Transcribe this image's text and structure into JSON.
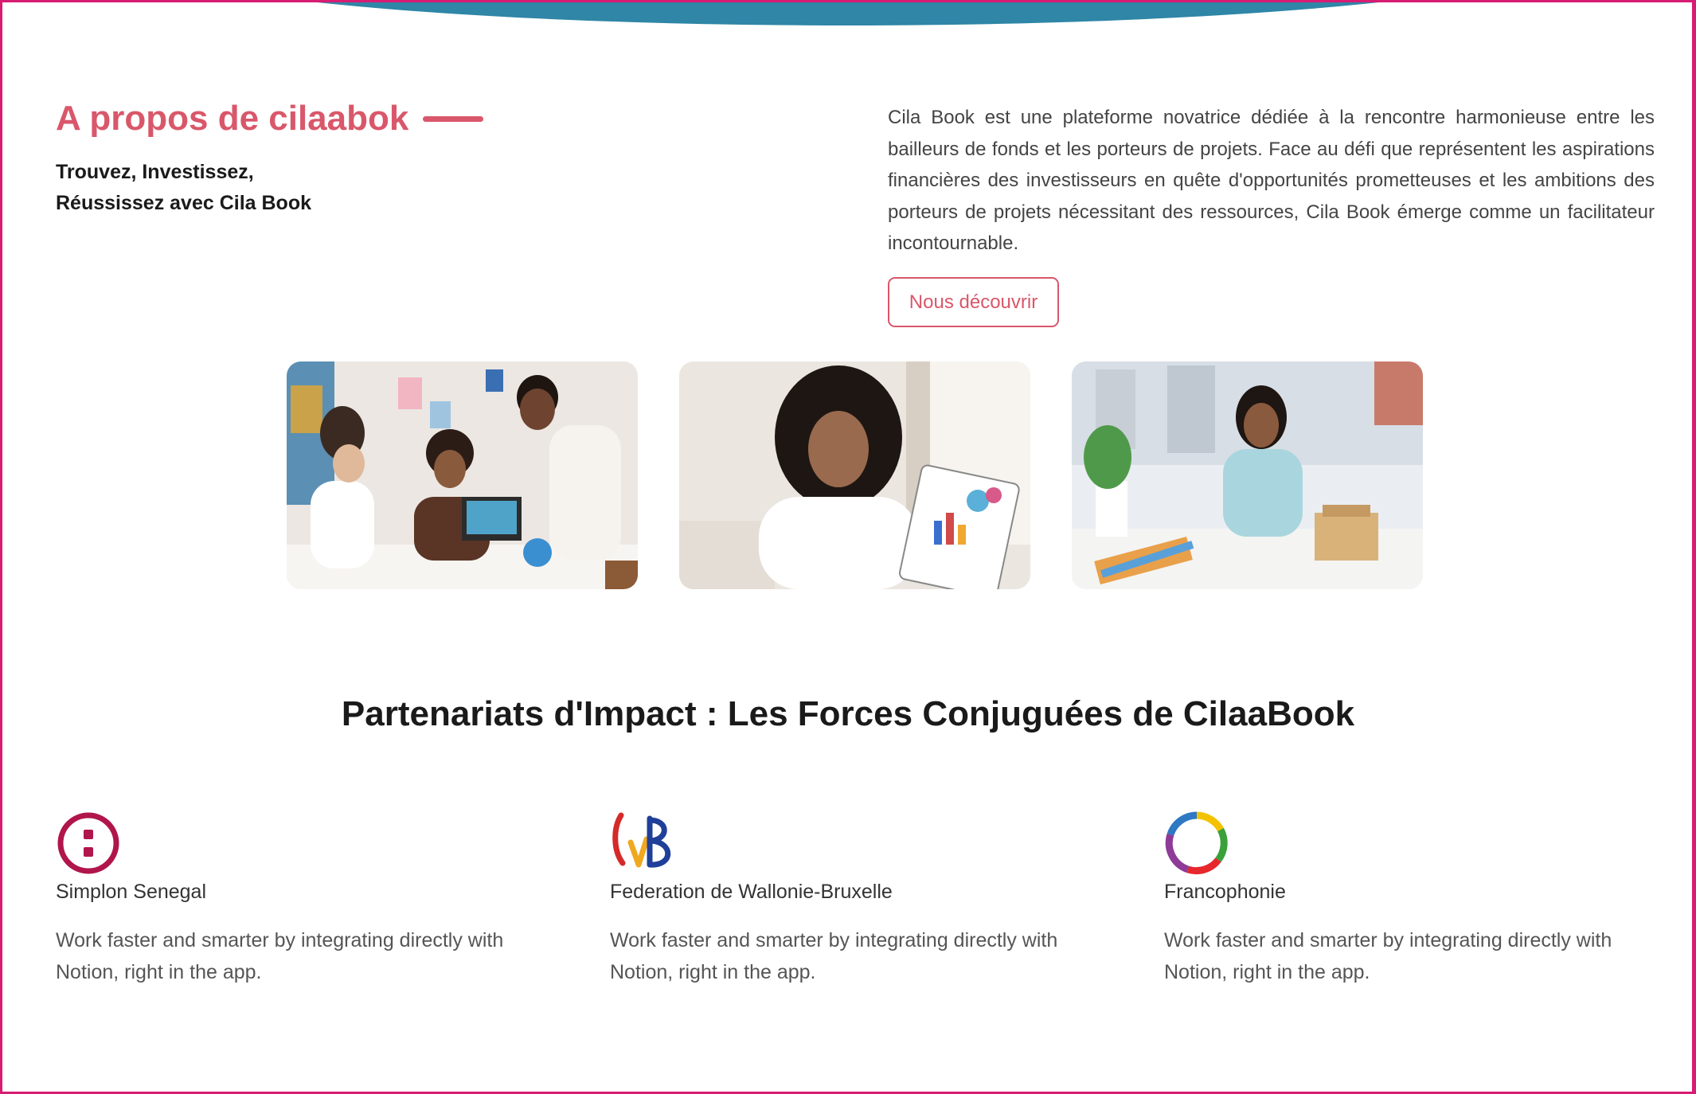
{
  "about": {
    "title": "A propos de cilaabok",
    "subtitle_line1": "Trouvez, Investissez,",
    "subtitle_line2": "Réussissez avec Cila Book",
    "description": "Cila Book est une plateforme novatrice dédiée à la rencontre harmonieuse entre les bailleurs de fonds et les porteurs de projets. Face au défi que représentent les aspirations financières des investisseurs en quête d'opportunités prometteuses et les ambitions des porteurs de projets nécessitant des ressources, Cila Book émerge comme un facilitateur incontournable.",
    "button_label": "Nous découvrir"
  },
  "photos": [
    {
      "icon": "team-meeting-photo"
    },
    {
      "icon": "woman-with-chart-photo"
    },
    {
      "icon": "woman-at-desk-photo"
    }
  ],
  "partners": {
    "heading": "Partenariats d'Impact : Les Forces Conjuguées de CilaaBook",
    "items": [
      {
        "name": "Simplon Senegal",
        "description": "Work faster and smarter by integrating directly with Notion, right in the app.",
        "icon": "simplon-logo-icon"
      },
      {
        "name": "Federation de Wallonie-Bruxelle",
        "description": "Work faster and smarter by integrating directly with Notion, right in the app.",
        "icon": "wallonie-bruxelles-logo-icon"
      },
      {
        "name": "Francophonie",
        "description": "Work faster and smarter by integrating directly with Notion, right in the app.",
        "icon": "francophonie-logo-icon"
      }
    ]
  },
  "colors": {
    "accent": "#d9576a",
    "top_band": "#2f86a6",
    "frame": "#d81b73",
    "simplon": "#b0154b"
  }
}
